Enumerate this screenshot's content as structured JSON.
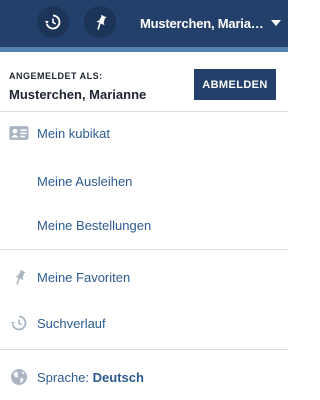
{
  "topbar": {
    "history_icon": "history-icon",
    "pin_icon": "pin-icon",
    "user_menu_label": "Musterchen, Mariane",
    "caret_icon": "caret-down-icon"
  },
  "login": {
    "caption": "ANGEMELDET ALS:",
    "name": "Musterchen, Marianne",
    "logout_label": "ABMELDEN"
  },
  "menu": {
    "account": {
      "label": "Mein kubikat",
      "icon": "id-card-icon"
    },
    "loans": {
      "label": "Meine Ausleihen"
    },
    "orders": {
      "label": "Meine Bestellungen"
    },
    "favorites": {
      "label": "Meine Favoriten",
      "icon": "pin-icon"
    },
    "history": {
      "label": "Suchverlauf",
      "icon": "history-icon"
    },
    "language": {
      "label": "Sprache: ",
      "value": "Deutsch",
      "icon": "globe-icon"
    }
  },
  "colors": {
    "header_bg": "#22406a",
    "header_border": "#5682b3",
    "link": "#2d5b8f",
    "icon_gray": "#aab5c4"
  }
}
